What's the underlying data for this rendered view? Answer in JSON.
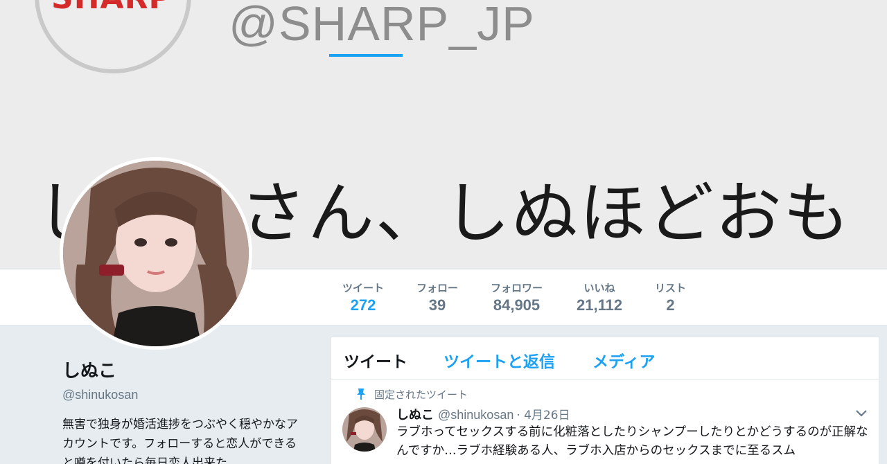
{
  "banner": {
    "logo_text": "SHARP",
    "handle": "@SHARP_JP",
    "tagline": "しぬこさん、しぬほどおも"
  },
  "nav": {
    "stats": [
      {
        "label": "ツイート",
        "value": "272",
        "active": true
      },
      {
        "label": "フォロー",
        "value": "39"
      },
      {
        "label": "フォロワー",
        "value": "84,905"
      },
      {
        "label": "いいね",
        "value": "21,112"
      },
      {
        "label": "リスト",
        "value": "2"
      }
    ]
  },
  "profile": {
    "name": "しぬこ",
    "handle": "@shinukosan",
    "bio": "無害で独身が婚活進捗をつぶやく穏やかなアカウントです。フォローすると恋人ができると噂を付いたら毎日恋人出来た"
  },
  "timeline": {
    "tabs": [
      "ツイート",
      "ツイートと返信",
      "メディア"
    ],
    "pinned_label": "固定されたツイート",
    "tweet": {
      "name": "しぬこ",
      "handle": "@shinukosan",
      "date": "· 4月26日",
      "text": "ラブホってセックスする前に化粧落としたりシャンプーしたりとかどうするのが正解なんですか…ラブホ経験ある人、ラブホ入店からのセックスまでに至るスム"
    }
  },
  "colors": {
    "accent": "#1da1f2",
    "text": "#14171a",
    "muted": "#657786",
    "page_bg": "#e6ecf0",
    "brand_red": "#d52a2a"
  }
}
